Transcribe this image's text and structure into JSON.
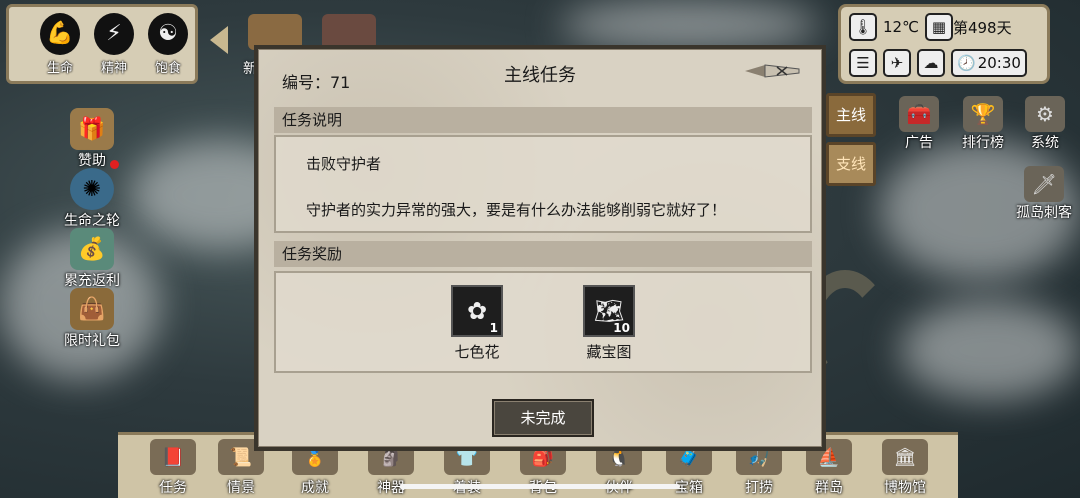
{
  "status_bar": {
    "life_label": "生命",
    "spirit_label": "精神",
    "satiety_label": "饱食"
  },
  "info_panel": {
    "temperature": "12℃",
    "day": "第498天",
    "time": "20:30"
  },
  "left_menu": [
    {
      "label": "赞助",
      "icon": "winged-chest-icon"
    },
    {
      "label": "生命之轮",
      "icon": "wheel-of-life-icon"
    },
    {
      "label": "累充返利",
      "icon": "money-bag-icon"
    },
    {
      "label": "限时礼包",
      "icon": "gift-bag-icon"
    }
  ],
  "right_menu": [
    {
      "label": "广告",
      "icon": "ad-chest-icon"
    },
    {
      "label": "排行榜",
      "icon": "trophy-icon"
    },
    {
      "label": "系统",
      "icon": "gear-icon"
    },
    {
      "label": "孤岛刺客",
      "icon": "dagger-icon"
    }
  ],
  "top_peek": {
    "new_label": "新"
  },
  "bottom_menu": [
    {
      "label": "任务",
      "icon": "task-book-icon"
    },
    {
      "label": "情景",
      "icon": "scroll-map-icon"
    },
    {
      "label": "成就",
      "icon": "achievement-icon"
    },
    {
      "label": "神器",
      "icon": "artifact-icon"
    },
    {
      "label": "着装",
      "icon": "clothing-icon"
    },
    {
      "label": "背包",
      "icon": "backpack-icon"
    },
    {
      "label": "伙伴",
      "icon": "companion-icon"
    },
    {
      "label": "宝箱",
      "icon": "treasure-chest-icon"
    },
    {
      "label": "打捞",
      "icon": "salvage-icon"
    },
    {
      "label": "群岛",
      "icon": "ship-icon"
    },
    {
      "label": "博物馆",
      "icon": "museum-icon"
    }
  ],
  "dialog": {
    "id_label": "编号：71",
    "title": "主线任务",
    "description_header": "任务说明",
    "objective": "击败守护者",
    "description": "守护者的实力异常的强大，要是有什么办法能够削弱它就好了！",
    "reward_header": "任务奖励",
    "rewards": [
      {
        "name": "七色花",
        "qty": "1",
        "icon": "flower-icon"
      },
      {
        "name": "藏宝图",
        "qty": "10",
        "icon": "treasure-map-icon"
      }
    ],
    "status_button": "未完成"
  },
  "tabs": {
    "main": "主线",
    "side": "支线"
  }
}
